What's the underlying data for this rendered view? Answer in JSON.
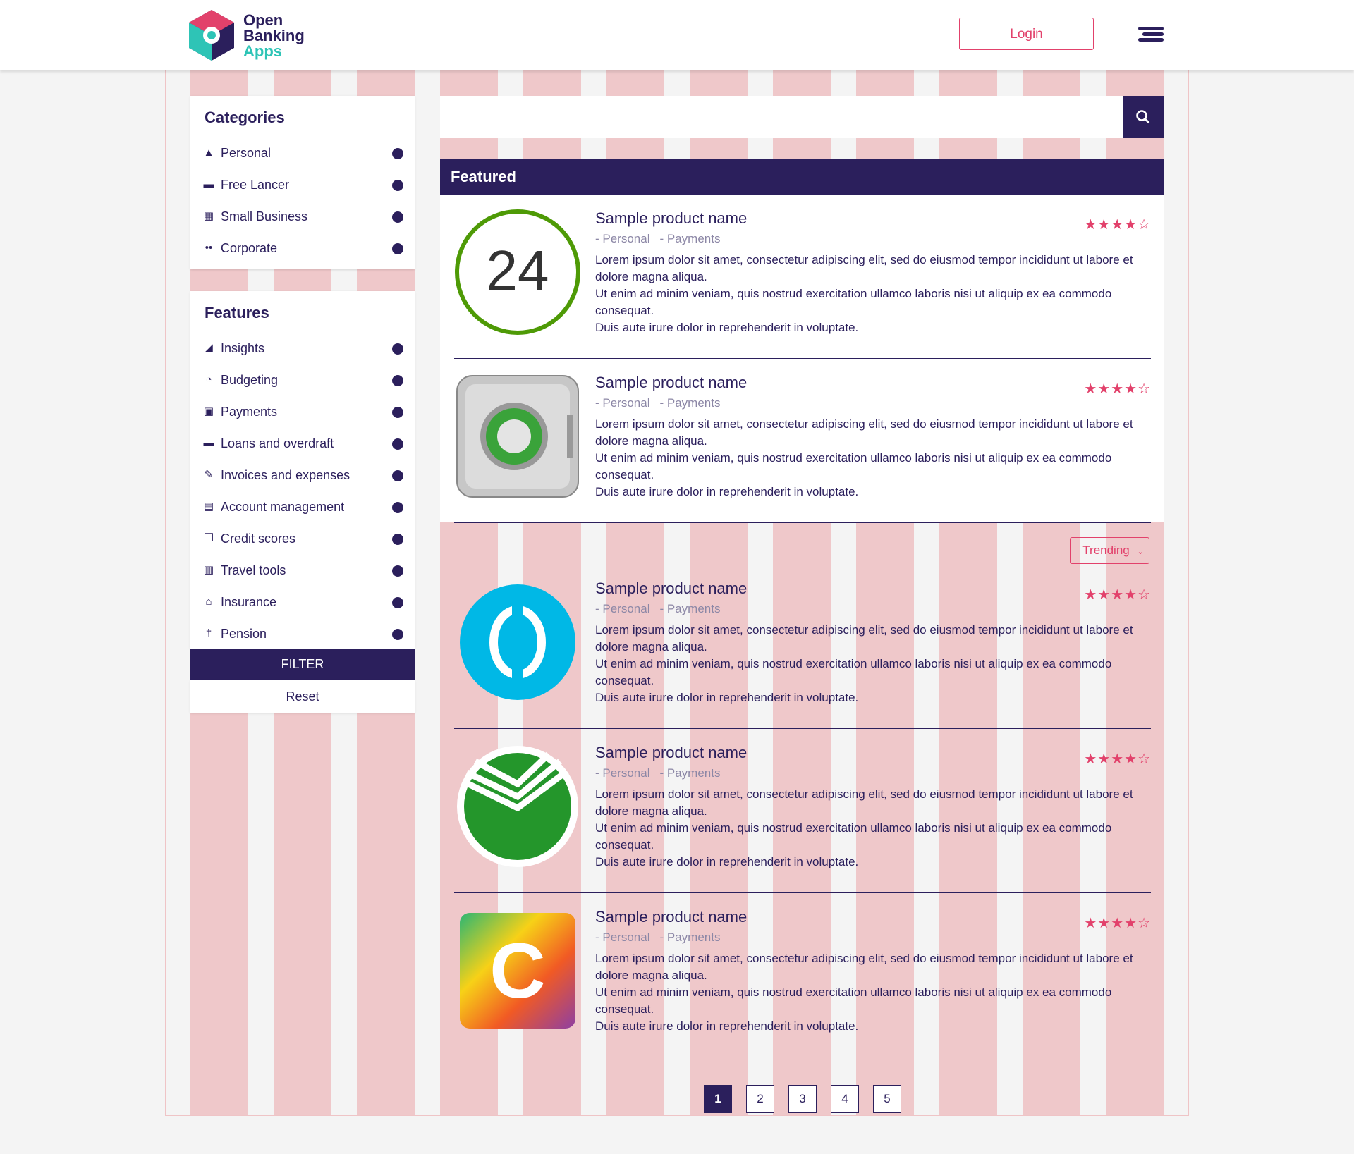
{
  "brand": {
    "line1": "Open",
    "line2": "Banking",
    "line3": "Apps"
  },
  "header": {
    "login_label": "Login"
  },
  "categories": {
    "title": "Categories",
    "items": [
      {
        "icon": "user-icon",
        "label": "Personal"
      },
      {
        "icon": "briefcase-icon",
        "label": "Free Lancer"
      },
      {
        "icon": "store-icon",
        "label": "Small Business"
      },
      {
        "icon": "users-icon",
        "label": "Corporate"
      }
    ]
  },
  "features": {
    "title": "Features",
    "items": [
      {
        "icon": "area-chart-icon",
        "label": "Insights"
      },
      {
        "icon": "pie-chart-icon",
        "label": "Budgeting"
      },
      {
        "icon": "money-icon",
        "label": "Payments"
      },
      {
        "icon": "credit-card-icon",
        "label": "Loans and overdraft"
      },
      {
        "icon": "edit-icon",
        "label": "Invoices and expenses"
      },
      {
        "icon": "id-card-icon",
        "label": "Account management"
      },
      {
        "icon": "copy-icon",
        "label": "Credit scores"
      },
      {
        "icon": "suitcase-icon",
        "label": "Travel tools"
      },
      {
        "icon": "bank-icon",
        "label": "Insurance"
      },
      {
        "icon": "elderly-icon",
        "label": "Pension"
      }
    ],
    "filter_label": "FILTER",
    "reset_label": "Reset"
  },
  "search": {
    "placeholder": ""
  },
  "featured": {
    "title": "Featured"
  },
  "sort": {
    "label": "Trending"
  },
  "products": [
    {
      "name": "Sample product name",
      "tags": [
        "- Personal",
        "- Payments"
      ],
      "desc": [
        "Lorem ipsum dolor sit amet, consectetur adipiscing elit, sed do eiusmod tempor incididunt ut labore et dolore magna aliqua.",
        "Ut enim ad minim veniam, quis nostrud exercitation ullamco laboris nisi ut aliquip ex ea commodo consequat.",
        "Duis aute irure dolor in reprehenderit in voluptate."
      ],
      "rating": 4,
      "logo_text": "24"
    },
    {
      "name": "Sample product name",
      "tags": [
        "- Personal",
        "- Payments"
      ],
      "desc": [
        "Lorem ipsum dolor sit amet, consectetur adipiscing elit, sed do eiusmod tempor incididunt ut labore et dolore magna aliqua.",
        "Ut enim ad minim veniam, quis nostrud exercitation ullamco laboris nisi ut aliquip ex ea commodo consequat.",
        "Duis aute irure dolor in reprehenderit in voluptate."
      ],
      "rating": 4
    },
    {
      "name": "Sample product name",
      "tags": [
        "- Personal",
        "- Payments"
      ],
      "desc": [
        "Lorem ipsum dolor sit amet, consectetur adipiscing elit, sed do eiusmod tempor incididunt ut labore et dolore magna aliqua.",
        "Ut enim ad minim veniam, quis nostrud exercitation ullamco laboris nisi ut aliquip ex ea commodo consequat.",
        "Duis aute irure dolor in reprehenderit in voluptate."
      ],
      "rating": 4
    },
    {
      "name": "Sample product name",
      "tags": [
        "- Personal",
        "- Payments"
      ],
      "desc": [
        "Lorem ipsum dolor sit amet, consectetur adipiscing elit, sed do eiusmod tempor incididunt ut labore et dolore magna aliqua.",
        "Ut enim ad minim veniam, quis nostrud exercitation ullamco laboris nisi ut aliquip ex ea commodo consequat.",
        "Duis aute irure dolor in reprehenderit in voluptate."
      ],
      "rating": 4
    },
    {
      "name": "Sample product name",
      "tags": [
        "- Personal",
        "- Payments"
      ],
      "desc": [
        "Lorem ipsum dolor sit amet, consectetur adipiscing elit, sed do eiusmod tempor incididunt ut labore et dolore magna aliqua.",
        "Ut enim ad minim veniam, quis nostrud exercitation ullamco laboris nisi ut aliquip ex ea commodo consequat.",
        "Duis aute irure dolor in reprehenderit in voluptate."
      ],
      "rating": 4,
      "logo_text": "C"
    }
  ],
  "pagination": {
    "pages": [
      "1",
      "2",
      "3",
      "4",
      "5"
    ],
    "current": "1"
  },
  "colors": {
    "primary": "#2b1f5c",
    "accent": "#e2416b",
    "teal": "#2ec4b6",
    "grid": "#efc8ca"
  }
}
